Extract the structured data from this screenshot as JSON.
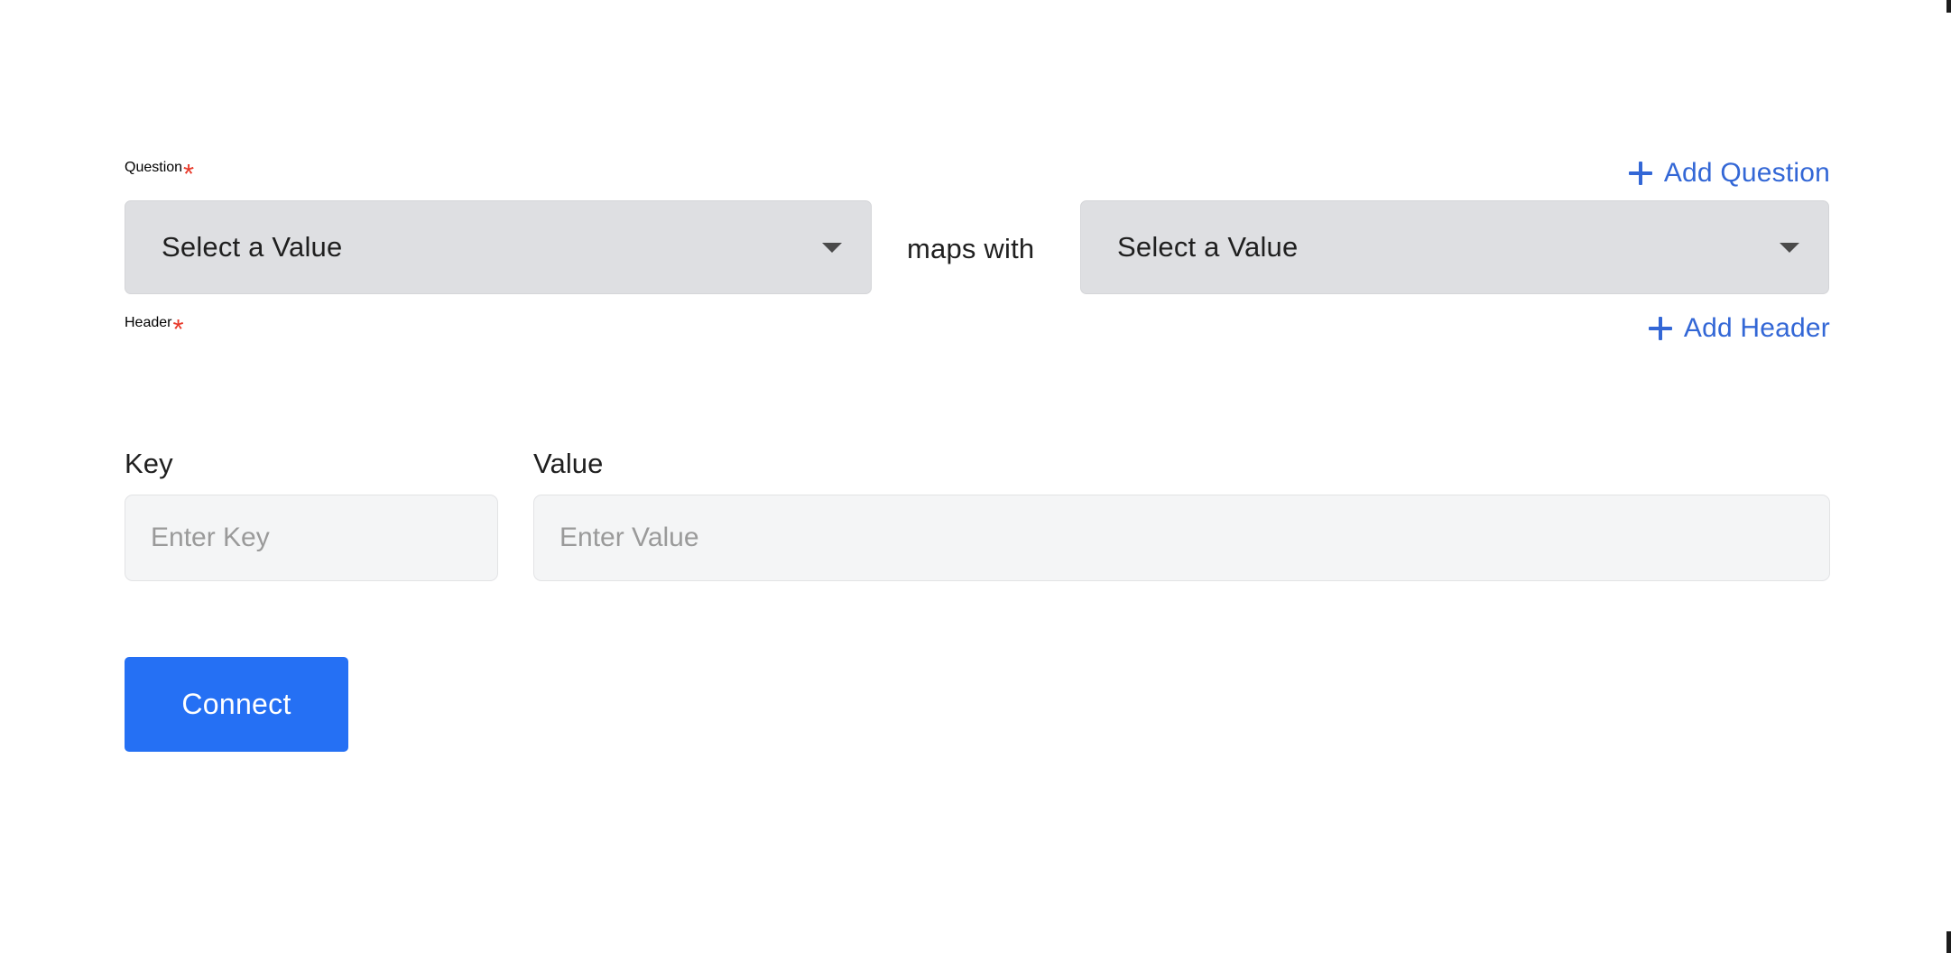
{
  "colors": {
    "accent_blue": "#2570f4",
    "link_blue": "#3367d6",
    "required_red": "#e8392a",
    "select_bg": "#dedfe2",
    "input_bg": "#f4f5f6",
    "text": "#1f1f1f",
    "placeholder": "#9a9a9a",
    "page_bg": "#ffffff"
  },
  "question_section": {
    "label": "Question",
    "required_marker": "*",
    "add_link": {
      "label": "Add Question",
      "icon": "plus-icon"
    },
    "source_select": {
      "value": "Select a Value",
      "icon": "chevron-down-icon"
    },
    "connector_text": "maps with",
    "target_select": {
      "value": "Select a Value",
      "icon": "chevron-down-icon"
    }
  },
  "header_section": {
    "label": "Header",
    "required_marker": "*",
    "add_link": {
      "label": "Add Header",
      "icon": "plus-icon"
    },
    "key_field": {
      "label": "Key",
      "value": "",
      "placeholder": "Enter Key"
    },
    "value_field": {
      "label": "Value",
      "value": "",
      "placeholder": "Enter Value"
    }
  },
  "actions": {
    "submit_label": "Connect"
  }
}
